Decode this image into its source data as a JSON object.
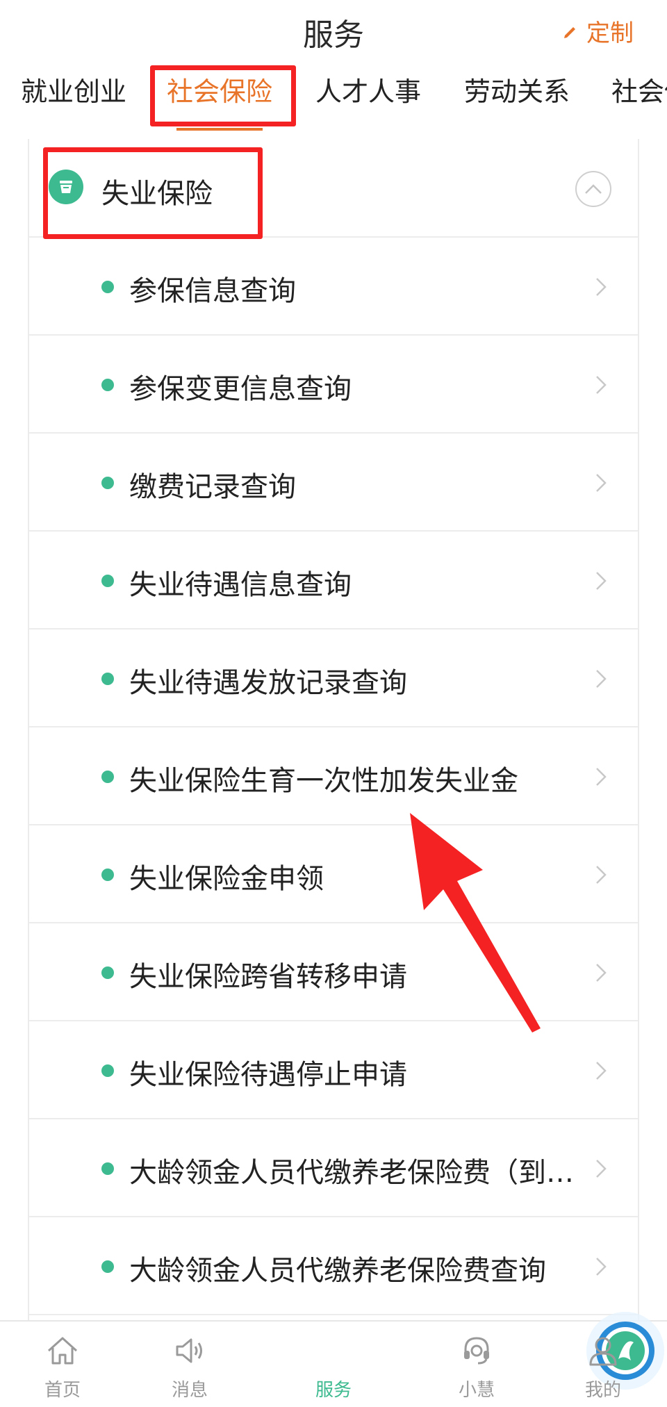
{
  "header": {
    "title": "服务",
    "customize_label": "定制"
  },
  "tabs": [
    {
      "label": "就业创业"
    },
    {
      "label": "社会保险"
    },
    {
      "label": "人才人事"
    },
    {
      "label": "劳动关系"
    },
    {
      "label": "社会保"
    }
  ],
  "active_tab": "社会保险",
  "group": {
    "title": "失业保险",
    "icon": "insurance-icon",
    "expanded": true
  },
  "items": [
    {
      "label": "参保信息查询"
    },
    {
      "label": "参保变更信息查询"
    },
    {
      "label": "缴费记录查询"
    },
    {
      "label": "失业待遇信息查询"
    },
    {
      "label": "失业待遇发放记录查询"
    },
    {
      "label": "失业保险生育一次性加发失业金"
    },
    {
      "label": "失业保险金申领"
    },
    {
      "label": "失业保险跨省转移申请"
    },
    {
      "label": "失业保险待遇停止申请"
    },
    {
      "label": "大龄领金人员代缴养老保险费（到…"
    },
    {
      "label": "大龄领金人员代缴养老保险费查询"
    }
  ],
  "bottom_nav": [
    {
      "label": "首页",
      "icon": "home-icon"
    },
    {
      "label": "消息",
      "icon": "speaker-icon"
    },
    {
      "label": "服务",
      "icon": "service-logo-icon"
    },
    {
      "label": "小慧",
      "icon": "headset-icon"
    },
    {
      "label": "我的",
      "icon": "user-icon"
    }
  ],
  "colors": {
    "accent_orange": "#e8742a",
    "accent_green": "#3dba8f",
    "annotation_red": "#f42222"
  }
}
